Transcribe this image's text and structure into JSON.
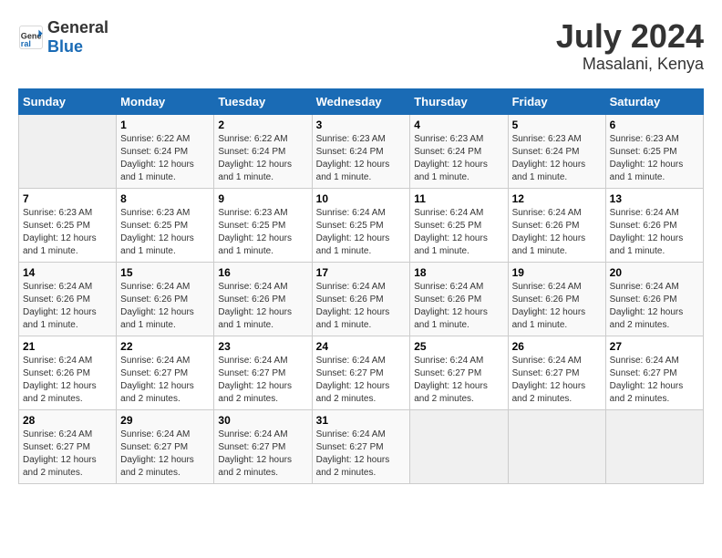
{
  "header": {
    "logo_general": "General",
    "logo_blue": "Blue",
    "month": "July 2024",
    "location": "Masalani, Kenya"
  },
  "weekdays": [
    "Sunday",
    "Monday",
    "Tuesday",
    "Wednesday",
    "Thursday",
    "Friday",
    "Saturday"
  ],
  "weeks": [
    [
      {
        "day": "",
        "info": ""
      },
      {
        "day": "1",
        "info": "Sunrise: 6:22 AM\nSunset: 6:24 PM\nDaylight: 12 hours\nand 1 minute."
      },
      {
        "day": "2",
        "info": "Sunrise: 6:22 AM\nSunset: 6:24 PM\nDaylight: 12 hours\nand 1 minute."
      },
      {
        "day": "3",
        "info": "Sunrise: 6:23 AM\nSunset: 6:24 PM\nDaylight: 12 hours\nand 1 minute."
      },
      {
        "day": "4",
        "info": "Sunrise: 6:23 AM\nSunset: 6:24 PM\nDaylight: 12 hours\nand 1 minute."
      },
      {
        "day": "5",
        "info": "Sunrise: 6:23 AM\nSunset: 6:24 PM\nDaylight: 12 hours\nand 1 minute."
      },
      {
        "day": "6",
        "info": "Sunrise: 6:23 AM\nSunset: 6:25 PM\nDaylight: 12 hours\nand 1 minute."
      }
    ],
    [
      {
        "day": "7",
        "info": "Sunrise: 6:23 AM\nSunset: 6:25 PM\nDaylight: 12 hours\nand 1 minute."
      },
      {
        "day": "8",
        "info": "Sunrise: 6:23 AM\nSunset: 6:25 PM\nDaylight: 12 hours\nand 1 minute."
      },
      {
        "day": "9",
        "info": "Sunrise: 6:23 AM\nSunset: 6:25 PM\nDaylight: 12 hours\nand 1 minute."
      },
      {
        "day": "10",
        "info": "Sunrise: 6:24 AM\nSunset: 6:25 PM\nDaylight: 12 hours\nand 1 minute."
      },
      {
        "day": "11",
        "info": "Sunrise: 6:24 AM\nSunset: 6:25 PM\nDaylight: 12 hours\nand 1 minute."
      },
      {
        "day": "12",
        "info": "Sunrise: 6:24 AM\nSunset: 6:26 PM\nDaylight: 12 hours\nand 1 minute."
      },
      {
        "day": "13",
        "info": "Sunrise: 6:24 AM\nSunset: 6:26 PM\nDaylight: 12 hours\nand 1 minute."
      }
    ],
    [
      {
        "day": "14",
        "info": "Sunrise: 6:24 AM\nSunset: 6:26 PM\nDaylight: 12 hours\nand 1 minute."
      },
      {
        "day": "15",
        "info": "Sunrise: 6:24 AM\nSunset: 6:26 PM\nDaylight: 12 hours\nand 1 minute."
      },
      {
        "day": "16",
        "info": "Sunrise: 6:24 AM\nSunset: 6:26 PM\nDaylight: 12 hours\nand 1 minute."
      },
      {
        "day": "17",
        "info": "Sunrise: 6:24 AM\nSunset: 6:26 PM\nDaylight: 12 hours\nand 1 minute."
      },
      {
        "day": "18",
        "info": "Sunrise: 6:24 AM\nSunset: 6:26 PM\nDaylight: 12 hours\nand 1 minute."
      },
      {
        "day": "19",
        "info": "Sunrise: 6:24 AM\nSunset: 6:26 PM\nDaylight: 12 hours\nand 1 minute."
      },
      {
        "day": "20",
        "info": "Sunrise: 6:24 AM\nSunset: 6:26 PM\nDaylight: 12 hours\nand 2 minutes."
      }
    ],
    [
      {
        "day": "21",
        "info": "Sunrise: 6:24 AM\nSunset: 6:26 PM\nDaylight: 12 hours\nand 2 minutes."
      },
      {
        "day": "22",
        "info": "Sunrise: 6:24 AM\nSunset: 6:27 PM\nDaylight: 12 hours\nand 2 minutes."
      },
      {
        "day": "23",
        "info": "Sunrise: 6:24 AM\nSunset: 6:27 PM\nDaylight: 12 hours\nand 2 minutes."
      },
      {
        "day": "24",
        "info": "Sunrise: 6:24 AM\nSunset: 6:27 PM\nDaylight: 12 hours\nand 2 minutes."
      },
      {
        "day": "25",
        "info": "Sunrise: 6:24 AM\nSunset: 6:27 PM\nDaylight: 12 hours\nand 2 minutes."
      },
      {
        "day": "26",
        "info": "Sunrise: 6:24 AM\nSunset: 6:27 PM\nDaylight: 12 hours\nand 2 minutes."
      },
      {
        "day": "27",
        "info": "Sunrise: 6:24 AM\nSunset: 6:27 PM\nDaylight: 12 hours\nand 2 minutes."
      }
    ],
    [
      {
        "day": "28",
        "info": "Sunrise: 6:24 AM\nSunset: 6:27 PM\nDaylight: 12 hours\nand 2 minutes."
      },
      {
        "day": "29",
        "info": "Sunrise: 6:24 AM\nSunset: 6:27 PM\nDaylight: 12 hours\nand 2 minutes."
      },
      {
        "day": "30",
        "info": "Sunrise: 6:24 AM\nSunset: 6:27 PM\nDaylight: 12 hours\nand 2 minutes."
      },
      {
        "day": "31",
        "info": "Sunrise: 6:24 AM\nSunset: 6:27 PM\nDaylight: 12 hours\nand 2 minutes."
      },
      {
        "day": "",
        "info": ""
      },
      {
        "day": "",
        "info": ""
      },
      {
        "day": "",
        "info": ""
      }
    ]
  ]
}
